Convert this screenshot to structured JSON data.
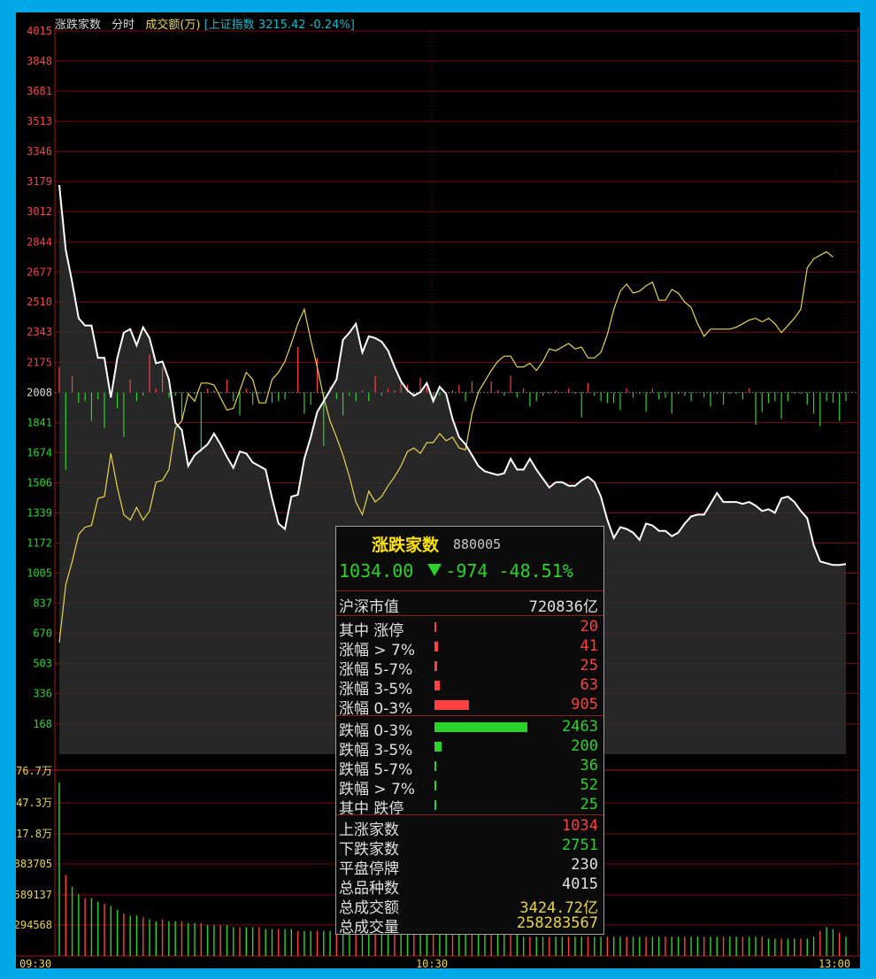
{
  "header": {
    "title": "涨跌家数",
    "period": "分时",
    "amount_label": "成交额(万)",
    "index_label": "[上证指数 3215.42 -0.24%]"
  },
  "colors": {
    "grid": "#7a0c0c",
    "index_line": "#ffffff",
    "aux_line": "#e8d44d",
    "up": "#ff4040",
    "down": "#2bd42b",
    "axis_text_up": "#ff4040",
    "axis_text_down": "#2bd42b",
    "axis_text_vol": "#e8d44d"
  },
  "chart_data": [
    {
      "type": "line",
      "title": "涨跌家数",
      "ylim": [
        0,
        4015
      ],
      "y_ticks_upper": [
        "4015",
        "3848",
        "3681",
        "3513",
        "3346",
        "3179",
        "3012",
        "2844",
        "2677",
        "2510",
        "2343",
        "2175"
      ],
      "y_tick_mid": "2008",
      "y_ticks_lower": [
        "1841",
        "1674",
        "1506",
        "1339",
        "1172",
        "1005",
        "837",
        "670",
        "503",
        "336",
        "168"
      ],
      "baseline": 2008,
      "x_ticks": [
        "09:30",
        "10:30",
        "13:00"
      ],
      "series": [
        {
          "name": "涨跌家数",
          "values": [
            3160,
            2800,
            2620,
            2420,
            2380,
            2380,
            2200,
            2200,
            1980,
            2200,
            2340,
            2360,
            2270,
            2370,
            2310,
            2170,
            2180,
            2080,
            1840,
            1800,
            1600,
            1660,
            1690,
            1720,
            1780,
            1720,
            1650,
            1590,
            1680,
            1670,
            1620,
            1600,
            1580,
            1420,
            1280,
            1250,
            1430,
            1440,
            1640,
            1760,
            1900,
            1960,
            2020,
            2080,
            2300,
            2340,
            2390,
            2230,
            2320,
            2310,
            2290,
            2240,
            2150,
            2070,
            2020,
            1990,
            2010,
            2060,
            1960,
            2040,
            2000,
            1860,
            1760,
            1720,
            1660,
            1600,
            1570,
            1560,
            1550,
            1560,
            1640,
            1580,
            1580,
            1640,
            1580,
            1530,
            1480,
            1510,
            1510,
            1490,
            1490,
            1520,
            1540,
            1510,
            1430,
            1300,
            1200,
            1260,
            1250,
            1230,
            1190,
            1280,
            1270,
            1240,
            1240,
            1210,
            1230,
            1280,
            1320,
            1330,
            1330,
            1390,
            1450,
            1400,
            1400,
            1400,
            1390,
            1400,
            1380,
            1350,
            1360,
            1340,
            1420,
            1430,
            1400,
            1350,
            1310,
            1160,
            1070,
            1060,
            1050,
            1050,
            1055
          ]
        },
        {
          "name": "yellow",
          "values": [
            620,
            940,
            1070,
            1220,
            1260,
            1270,
            1420,
            1430,
            1670,
            1480,
            1330,
            1300,
            1370,
            1300,
            1350,
            1510,
            1520,
            1580,
            1810,
            1850,
            2000,
            1960,
            2060,
            2060,
            2050,
            1980,
            1910,
            1920,
            2020,
            2120,
            2080,
            1950,
            1950,
            2080,
            2120,
            2180,
            2280,
            2390,
            2470,
            2300,
            2150,
            1980,
            1850,
            1760,
            1660,
            1540,
            1400,
            1330,
            1460,
            1400,
            1430,
            1490,
            1540,
            1600,
            1680,
            1700,
            1670,
            1730,
            1730,
            1780,
            1740,
            1760,
            1700,
            1690,
            1890,
            2010,
            2070,
            2130,
            2180,
            2210,
            2210,
            2150,
            2150,
            2170,
            2130,
            2180,
            2250,
            2240,
            2260,
            2280,
            2250,
            2260,
            2200,
            2200,
            2230,
            2330,
            2470,
            2570,
            2610,
            2560,
            2570,
            2600,
            2620,
            2520,
            2520,
            2580,
            2560,
            2510,
            2480,
            2390,
            2320,
            2360,
            2360,
            2360,
            2360,
            2370,
            2390,
            2410,
            2420,
            2400,
            2420,
            2390,
            2340,
            2380,
            2420,
            2470,
            2700,
            2750,
            2770,
            2790,
            2760
          ]
        },
        {
          "name": "bars",
          "values": [
            2150,
            1580,
            2100,
            1950,
            1960,
            1850,
            1970,
            1810,
            2010,
            1920,
            1760,
            2080,
            1960,
            1990,
            2220,
            2030,
            2150,
            1980,
            1990,
            1850,
            2000,
            2000,
            1680,
            2030,
            2020,
            2000,
            2080,
            1960,
            1880,
            2030,
            1940,
            2000,
            2010,
            1950,
            1960,
            1970,
            2010,
            2260,
            1890,
            1940,
            2200,
            1710,
            2040,
            1970,
            1880,
            1990,
            1960,
            2020,
            1960,
            2100,
            1990,
            2030,
            2020,
            2060,
            2050,
            1990,
            2090,
            2040,
            1950,
            1990,
            2010,
            2020,
            2050,
            1960,
            2070,
            2000,
            2010,
            2070,
            2020,
            1990,
            2100,
            1980,
            2030,
            1930,
            1960,
            1990,
            2000,
            2020,
            2010,
            2030,
            2000,
            1870,
            2060,
            1990,
            1960,
            1950,
            1950,
            1910,
            2030,
            1980,
            2000,
            1900,
            2030,
            1970,
            1980,
            1890,
            2000,
            1990,
            1960,
            2010,
            1980,
            1930,
            2000,
            1940,
            2000,
            2000,
            1970,
            2030,
            1830,
            1900,
            1950,
            1960,
            1860,
            1960,
            2000,
            2000,
            1940,
            1890,
            1820,
            1960,
            1950,
            1850,
            1960
          ]
        }
      ]
    },
    {
      "type": "bar",
      "title": "成交额(万)",
      "y_ticks": [
        "76.7万",
        "47.3万",
        "17.8万",
        "883705",
        "589137",
        "294568"
      ],
      "series": [
        {
          "name": "成交额(万)",
          "values": [
            900,
            420,
            360,
            320,
            300,
            300,
            280,
            270,
            260,
            240,
            220,
            210,
            210,
            200,
            190,
            180,
            190,
            180,
            180,
            180,
            170,
            170,
            170,
            160,
            160,
            160,
            160,
            150,
            150,
            150,
            150,
            150,
            140,
            140,
            140,
            140,
            140,
            130,
            130,
            130,
            130,
            130,
            130,
            130,
            130,
            120,
            120,
            120,
            120,
            120,
            120,
            120,
            120,
            120,
            120,
            120,
            110,
            110,
            110,
            110,
            110,
            110,
            110,
            110,
            110,
            110,
            110,
            110,
            110,
            110,
            110,
            110,
            100,
            100,
            100,
            100,
            100,
            100,
            100,
            100,
            100,
            100,
            100,
            100,
            100,
            100,
            100,
            100,
            100,
            100,
            100,
            100,
            100,
            100,
            100,
            100,
            100,
            100,
            100,
            100,
            100,
            100,
            100,
            100,
            100,
            100,
            100,
            100,
            100,
            100,
            90,
            90,
            90,
            90,
            90,
            90,
            90,
            100,
            130,
            150,
            140,
            120,
            100
          ]
        }
      ]
    }
  ],
  "panel": {
    "title": "涨跌家数",
    "code": "880005",
    "price": "1034.00",
    "change": "-974",
    "pct": "-48.51%",
    "market_cap_label": "沪深市值",
    "market_cap_value": "720836亿",
    "up_rows": [
      {
        "label": "其中 涨停",
        "value": "20",
        "share": 0.02
      },
      {
        "label": "涨幅 > 7%",
        "value": "41",
        "share": 0.04
      },
      {
        "label": "涨幅 5-7%",
        "value": "25",
        "share": 0.025
      },
      {
        "label": "涨幅 3-5%",
        "value": "63",
        "share": 0.06
      },
      {
        "label": "涨幅 0-3%",
        "value": "905",
        "share": 0.37
      }
    ],
    "down_rows": [
      {
        "label": "跌幅 0-3%",
        "value": "2463",
        "share": 1.0
      },
      {
        "label": "跌幅 3-5%",
        "value": "200",
        "share": 0.08
      },
      {
        "label": "跌幅 5-7%",
        "value": "36",
        "share": 0.02
      },
      {
        "label": "跌幅 > 7%",
        "value": "52",
        "share": 0.02
      },
      {
        "label": "其中 跌停",
        "value": "25",
        "share": 0.02
      }
    ],
    "summary": [
      {
        "label": "上涨家数",
        "value": "1034",
        "tone": "red"
      },
      {
        "label": "下跌家数",
        "value": "2751",
        "tone": "green"
      },
      {
        "label": "平盘停牌",
        "value": "230",
        "tone": "white"
      },
      {
        "label": "总品种数",
        "value": "4015",
        "tone": "white"
      },
      {
        "label": "总成交额",
        "value": "3424.72亿",
        "tone": "yellow"
      },
      {
        "label": "总成交量",
        "value": "258283567",
        "tone": "yellow"
      }
    ]
  }
}
